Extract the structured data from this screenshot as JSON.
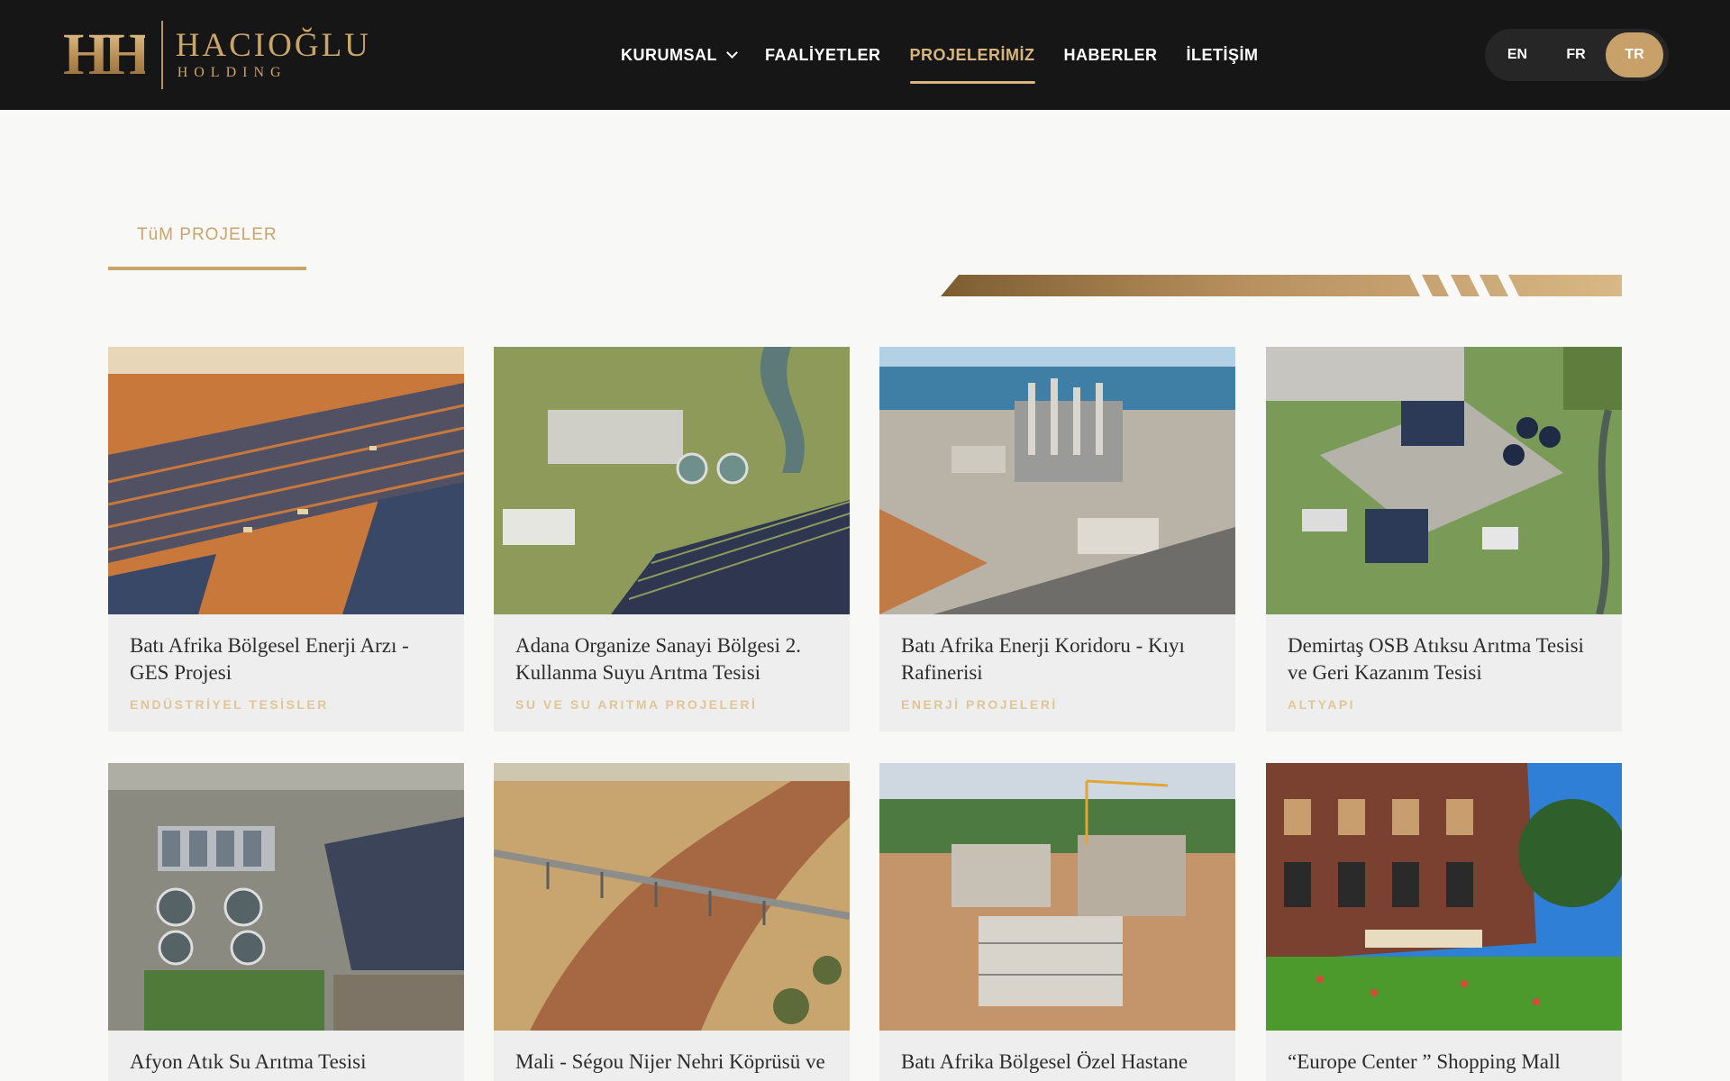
{
  "brand": {
    "mark": "HH",
    "name": "HACIOĞLU",
    "sub": "HOLDING"
  },
  "nav": [
    {
      "label": "KURUMSAL",
      "dropdown": true,
      "active": false
    },
    {
      "label": "FAALİYETLER",
      "active": false
    },
    {
      "label": "PROJELERİMİZ",
      "active": true
    },
    {
      "label": "HABERLER",
      "active": false
    },
    {
      "label": "İLETİŞİM",
      "active": false
    }
  ],
  "languages": [
    {
      "code": "EN",
      "active": false
    },
    {
      "code": "FR",
      "active": false
    },
    {
      "code": "TR",
      "active": true
    }
  ],
  "tabs": [
    {
      "label": "TüM PROJELER",
      "active": true
    }
  ],
  "projects": [
    {
      "title": "Batı Afrika Bölgesel Enerji Arzı - GES Projesi",
      "category": "ENDÜSTRİYEL TESİSLER",
      "image": "solar farm construction"
    },
    {
      "title": "Adana Organize Sanayi Bölgesi 2. Kullanma Suyu Arıtma Tesisi",
      "category": "SU VE SU ARITMA PROJELERİ",
      "image": "water treatment plant with solar panels"
    },
    {
      "title": "Batı Afrika Enerji Koridoru - Kıyı Rafinerisi",
      "category": "ENERJİ PROJELERİ",
      "image": "coastal refinery"
    },
    {
      "title": "Demirtaş OSB Atıksu Arıtma Tesisi ve Geri Kazanım Tesisi",
      "category": "ALTYAPI",
      "image": "wastewater treatment facility"
    },
    {
      "title": "Afyon Atık Su Arıtma Tesisi",
      "category": "",
      "image": "wastewater treatment plant"
    },
    {
      "title": "Mali - Ségou Nijer Nehri Köprüsü ve",
      "category": "",
      "image": "river bridge"
    },
    {
      "title": "Batı Afrika Bölgesel Özel Hastane",
      "category": "",
      "image": "hospital construction site"
    },
    {
      "title": "“Europe Center ” Shopping Mall",
      "category": "",
      "image": "shopping mall"
    }
  ],
  "colors": {
    "header_bg": "#161616",
    "gold": "#c9a46b",
    "page_bg": "#f8f8f7",
    "card_bg": "#eeeeee"
  }
}
